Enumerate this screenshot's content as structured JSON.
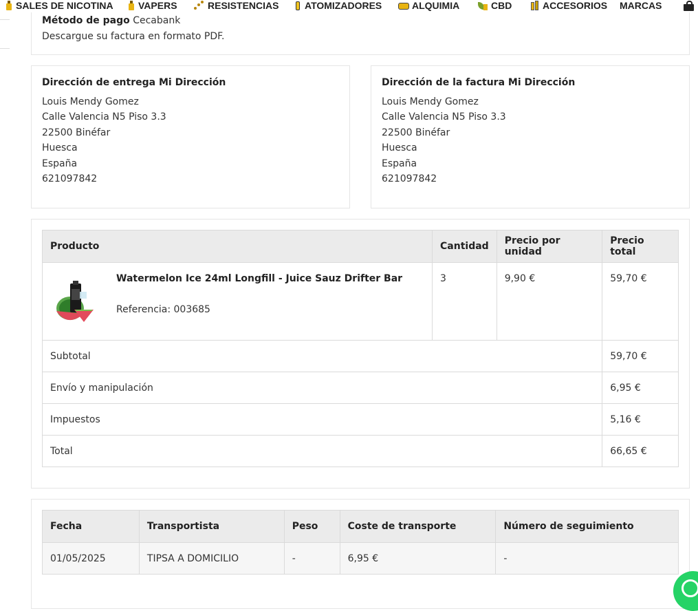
{
  "nav": {
    "items": [
      {
        "label": "SALES DE NICOTINA",
        "icon": "nicotine-bottle-icon"
      },
      {
        "label": "VAPERS",
        "icon": "vaper-icon"
      },
      {
        "label": "RESISTENCIAS",
        "icon": "coil-icon"
      },
      {
        "label": "ATOMIZADORES",
        "icon": "atomizer-icon"
      },
      {
        "label": "ALQUIMIA",
        "icon": "alchemy-icon"
      },
      {
        "label": "CBD",
        "icon": "cbd-leaf-icon"
      },
      {
        "label": "ACCESORIOS",
        "icon": "accessories-icon"
      },
      {
        "label": "MARCAS"
      }
    ],
    "cart_icon": "shopping-bag-icon"
  },
  "payment": {
    "method_label": "Método de pago",
    "method_value": "Cecabank",
    "invoice_text": "Descargue su factura en formato PDF."
  },
  "delivery_address": {
    "title": "Dirección de entrega Mi Dirección",
    "lines": [
      "Louis Mendy Gomez",
      "Calle Valencia N5 Piso 3.3",
      "22500 Binéfar",
      "Huesca",
      "España",
      "621097842"
    ]
  },
  "invoice_address": {
    "title": "Dirección de la factura Mi Dirección",
    "lines": [
      "Louis Mendy Gomez",
      "Calle Valencia N5 Piso 3.3",
      "22500 Binéfar",
      "Huesca",
      "España",
      "621097842"
    ]
  },
  "products": {
    "headers": [
      "Producto",
      "Cantidad",
      "Precio por unidad",
      "Precio total"
    ],
    "item": {
      "name": "Watermelon Ice 24ml Longfill - Juice Sauz Drifter Bar",
      "reference": "Referencia: 003685",
      "quantity": "3",
      "unit_price": "9,90 €",
      "total_price": "59,70 €"
    },
    "totals": [
      {
        "label": "Subtotal",
        "value": "59,70 €"
      },
      {
        "label": "Envío y manipulación",
        "value": "6,95 €"
      },
      {
        "label": "Impuestos",
        "value": "5,16 €"
      },
      {
        "label": "Total",
        "value": "66,65 €"
      }
    ]
  },
  "shipping": {
    "headers": [
      "Fecha",
      "Transportista",
      "Peso",
      "Coste de transporte",
      "Número de seguimiento"
    ],
    "row": [
      "01/05/2025",
      "TIPSA A DOMICILIO",
      "-",
      "6,95 €",
      "-"
    ]
  },
  "colors": {
    "accent": "#e8b412",
    "header_bg": "#ebebeb",
    "whatsapp": "#25d366"
  }
}
